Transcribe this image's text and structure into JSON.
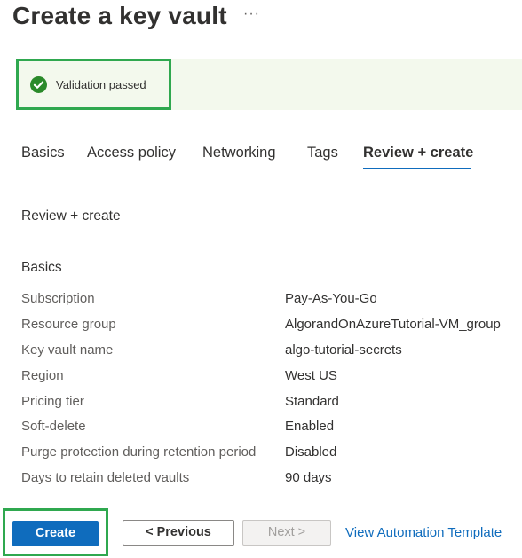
{
  "header": {
    "title": "Create a key vault",
    "more_label": "···"
  },
  "validation": {
    "message": "Validation passed",
    "icon": "check-circle-icon",
    "color": "#2fa84f"
  },
  "tabs": [
    {
      "label": "Basics",
      "active": false
    },
    {
      "label": "Access policy",
      "active": false
    },
    {
      "label": "Networking",
      "active": false
    },
    {
      "label": "Tags",
      "active": false
    },
    {
      "label": "Review + create",
      "active": true
    }
  ],
  "review": {
    "heading": "Review + create",
    "section_title": "Basics",
    "rows": [
      {
        "label": "Subscription",
        "value": "Pay-As-You-Go"
      },
      {
        "label": "Resource group",
        "value": "AlgorandOnAzureTutorial-VM_group"
      },
      {
        "label": "Key vault name",
        "value": "algo-tutorial-secrets"
      },
      {
        "label": "Region",
        "value": "West US"
      },
      {
        "label": "Pricing tier",
        "value": "Standard"
      },
      {
        "label": "Soft-delete",
        "value": "Enabled"
      },
      {
        "label": "Purge protection during retention period",
        "value": "Disabled"
      },
      {
        "label": "Days to retain deleted vaults",
        "value": "90 days"
      }
    ]
  },
  "footer": {
    "create_label": "Create",
    "previous_label": "< Previous",
    "next_label": "Next >",
    "template_link": "View Automation Template"
  },
  "colors": {
    "accent": "#0f6cbd",
    "highlight": "#2fa84f",
    "success_bg": "#f3f9ed"
  }
}
